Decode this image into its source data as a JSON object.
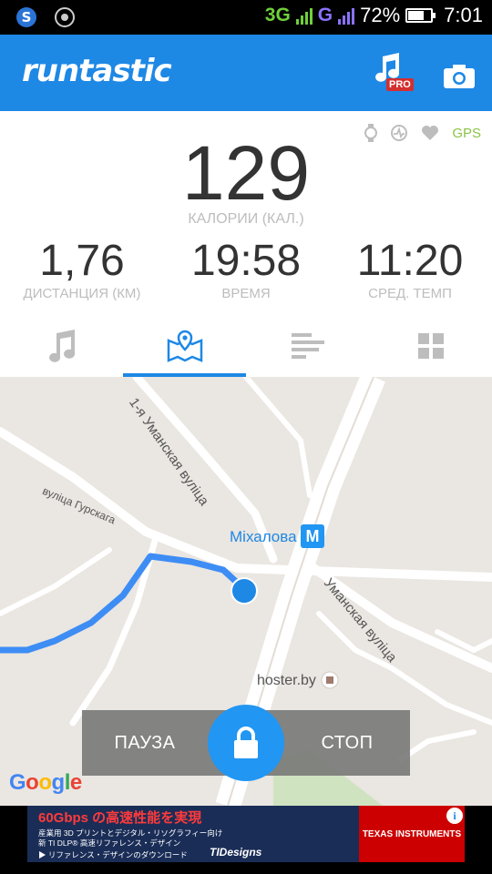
{
  "status_bar": {
    "app_icon": "s-icon",
    "gps_icon": "gps-status-icon",
    "network_primary": "3G",
    "network_secondary": "G",
    "battery_percent": "72%",
    "battery_level": 0.72,
    "time": "7:01"
  },
  "app_bar": {
    "logo": "runtastic",
    "pro_badge": "PRO",
    "colors": {
      "primary": "#1e88e5",
      "badge": "#d32f2f"
    }
  },
  "stats": {
    "indicators": {
      "gps_label": "GPS"
    },
    "calories": {
      "value": "129",
      "label": "КАЛОРИИ (КАЛ.)"
    },
    "distance": {
      "value": "1,76",
      "label": "ДИСТАНЦИЯ (КМ)"
    },
    "time": {
      "value": "19:58",
      "label": "ВРЕМЯ"
    },
    "pace": {
      "value": "11:20",
      "label": "СРЕД. ТЕМП"
    }
  },
  "tabs": [
    {
      "icon": "music-note-icon",
      "active": false
    },
    {
      "icon": "map-icon",
      "active": true
    },
    {
      "icon": "bars-list-icon",
      "active": false
    },
    {
      "icon": "grid-icon",
      "active": false
    }
  ],
  "map": {
    "streets": {
      "street1": "1-я Уманская вуліца",
      "street2": "вуліца Гурскага",
      "street3": "Уманская вуліца"
    },
    "metro_station": "Міхалова",
    "metro_badge": "M",
    "poi": "hoster.by",
    "attribution": "Google",
    "route_color": "#3d8df5"
  },
  "controls": {
    "pause": "ПАУЗА",
    "stop": "СТОП",
    "lock_icon": "lock-icon"
  },
  "ad": {
    "headline": "60Gbps の高速性能を実現",
    "line1": "産業用 3D プリントとデジタル・リソグラフィー向け",
    "line2": "新 TI DLP® 高速リファレンス・デザイン",
    "line3": "▶ リファレンス・デザインのダウンロード",
    "brand": "TIDesigns",
    "sponsor": "TEXAS INSTRUMENTS",
    "info": "i"
  }
}
